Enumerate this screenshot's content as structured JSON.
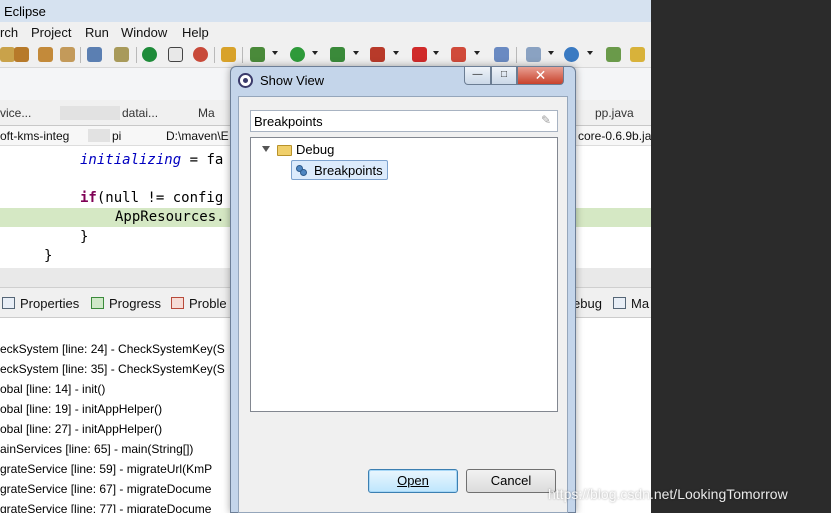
{
  "eclipse": {
    "title": "Eclipse",
    "menu": [
      "rch",
      "Project",
      "Run",
      "Window",
      "Help"
    ],
    "editor_tabs": [
      "vice...",
      "datai...",
      "Ma",
      "pp.java"
    ],
    "breadcrumb": [
      "oft-kms-integ",
      "pi",
      "D:\\maven\\E",
      "core-0.6.9b.ja"
    ],
    "code": {
      "line1_field": "initializing",
      "line1_rest": " = fa",
      "line2_kw": "if",
      "line2_rest": "(null != config",
      "line3": "AppResources.",
      "line4": "}",
      "line5": "}"
    },
    "view_tabs": {
      "properties": "Properties",
      "progress": "Progress",
      "problems": "Proble",
      "debug": "ebug",
      "ma": "Ma"
    },
    "console_lines": [
      "eckSystem [line: 24] - CheckSystemKey(S",
      "eckSystem [line: 35] - CheckSystemKey(S",
      "obal [line: 14] - init()",
      "obal [line: 19] - initAppHelper()",
      "obal [line: 27] - initAppHelper()",
      "ainServices [line: 65] - main(String[])",
      "grateService [line: 59] - migrateUrl(KmP",
      "grateService [line: 67] - migrateDocume",
      "grateService [line: 77] - migrateDocume"
    ]
  },
  "dialog": {
    "title": "Show View",
    "filter_value": "Breakpoints",
    "tree": {
      "folder": "Debug",
      "item": "Breakpoints"
    },
    "open_label": "Open",
    "cancel_label": "Cancel"
  },
  "watermark": "https://blog.csdn.net/LookingTomorrow"
}
